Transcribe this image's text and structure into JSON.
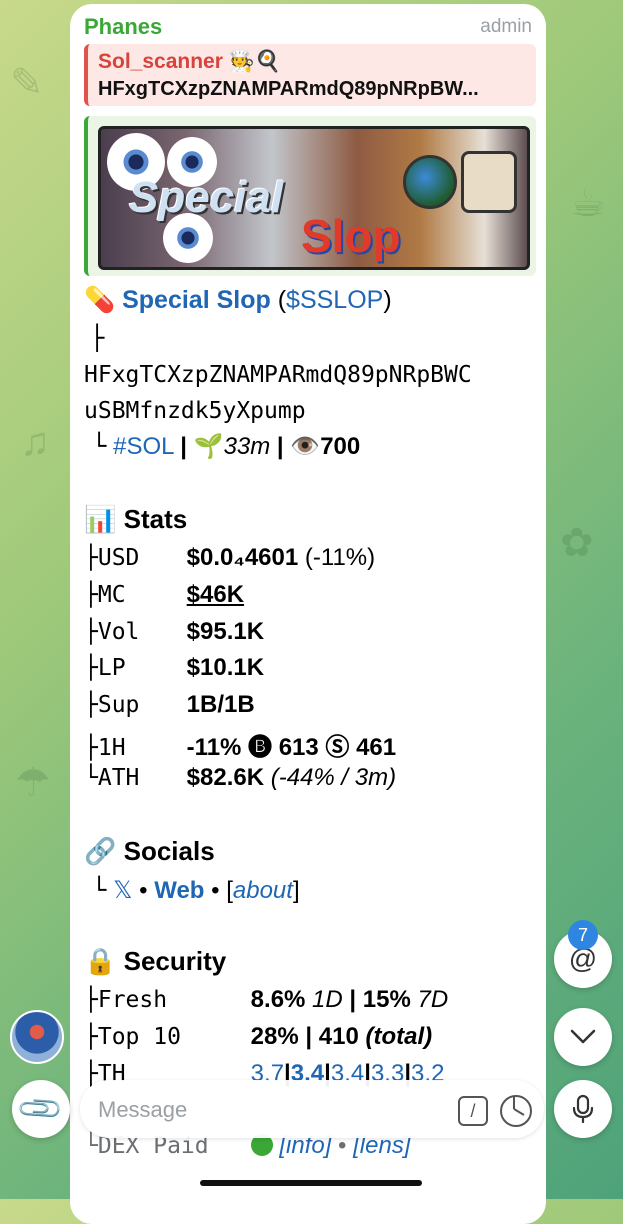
{
  "header": {
    "sender": "Phanes",
    "role": "admin"
  },
  "reply": {
    "name": "Sol_scanner 🧑‍🍳🍳",
    "text": "HFxgTCXzpZNAMPARmdQ89pNRpBW..."
  },
  "banner": {
    "word1": "Special",
    "word2": "Slop"
  },
  "token": {
    "pill": "💊",
    "name": "Special Slop",
    "ticker": "$SSLOP",
    "tree_top": "├",
    "address_line1": "HFxgTCXzpZNAMPARmdQ89pNRpBWC",
    "address_line2": "uSBMfnzdk5yXpump",
    "tree_end": "└",
    "chain": "#SOL",
    "age_icon": "🌱",
    "age": "33m",
    "views_icon": "👁️",
    "views": "700"
  },
  "stats": {
    "icon": "📊",
    "heading": "Stats",
    "rows": [
      {
        "key": "├USD",
        "value": "$0.0₄4601",
        "extra": "(-11%)"
      },
      {
        "key": "├MC",
        "value": "$46K",
        "extra": ""
      },
      {
        "key": "├Vol",
        "value": "$95.1K",
        "extra": ""
      },
      {
        "key": "├LP",
        "value": "$10.1K",
        "extra": ""
      },
      {
        "key": "├Sup",
        "value": "1B/1B",
        "extra": ""
      },
      {
        "key": "├1H",
        "value": "-11% 🅑 613 Ⓢ 461",
        "extra": ""
      },
      {
        "key": "└ATH",
        "value": "$82.6K",
        "extra": "(-44% / 3m)"
      }
    ]
  },
  "socials": {
    "icon": "🔗",
    "heading": "Socials",
    "tree": "└",
    "x": "𝕏",
    "sep1": "•",
    "web": "Web",
    "sep2": "•",
    "about_open": "[",
    "about": "about",
    "about_close": "]"
  },
  "security": {
    "icon": "🔒",
    "heading": "Security",
    "fresh_key": "├Fresh",
    "fresh_v1": "8.6%",
    "fresh_l1": "1D",
    "fresh_sep": "|",
    "fresh_v2": "15%",
    "fresh_l2": "7D",
    "top10_key": "├Top 10",
    "top10_v": "28% | 410",
    "top10_l": "(total)",
    "th_key": "├TH",
    "th_values": [
      "3.7",
      "3.4",
      "3.4",
      "3.3",
      "3.2"
    ],
    "dex_key": "└DEX Paid",
    "dex_info": "[info]",
    "dex_sep": "•",
    "dex_lens": "[lens]"
  },
  "composer": {
    "placeholder": "Message",
    "cmd": "/"
  },
  "mentions_badge": "7",
  "colors": {
    "link": "#1f66b5",
    "sender": "#3aa736",
    "reply_accent": "#e0524a"
  }
}
